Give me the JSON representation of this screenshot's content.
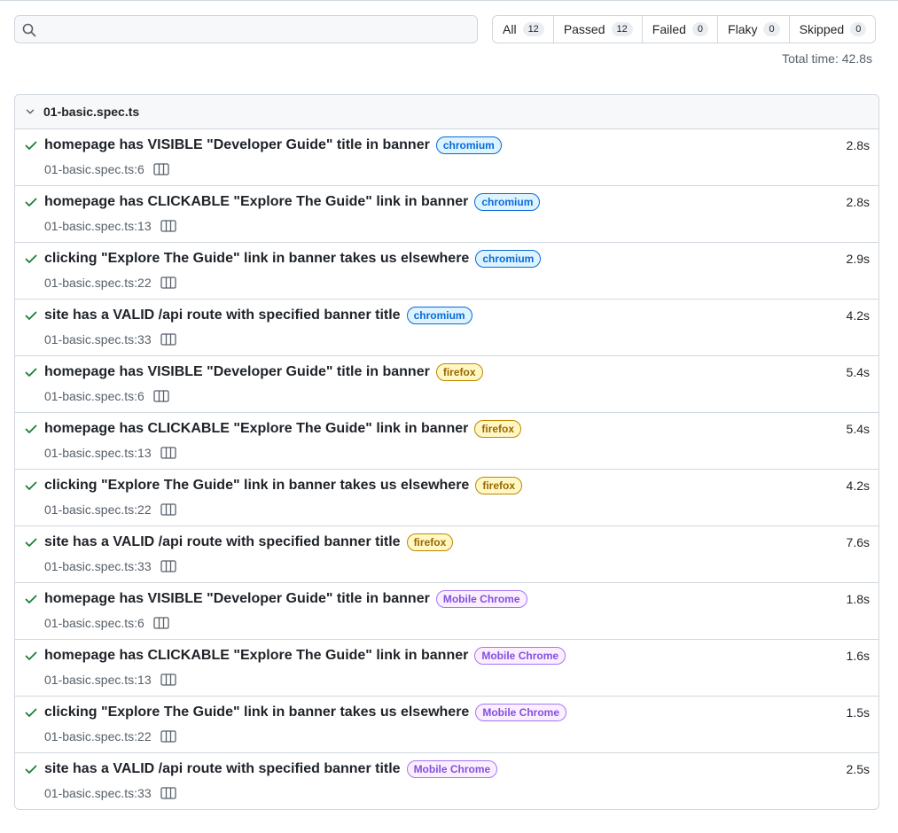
{
  "search": {
    "placeholder": "",
    "value": ""
  },
  "filters": [
    {
      "label": "All",
      "count": "12"
    },
    {
      "label": "Passed",
      "count": "12"
    },
    {
      "label": "Failed",
      "count": "0"
    },
    {
      "label": "Flaky",
      "count": "0"
    },
    {
      "label": "Skipped",
      "count": "0"
    }
  ],
  "total_time": "Total time: 42.8s",
  "file": {
    "name": "01-basic.spec.ts"
  },
  "colors": {
    "pass": "#1a7f37",
    "chromium": "#0969da",
    "firefox": "#bf8700",
    "mobile": "#8250df"
  },
  "tests": [
    {
      "title": "homepage has VISIBLE \"Developer Guide\" title in banner",
      "project": "chromium",
      "location": "01-basic.spec.ts:6",
      "duration": "2.8s",
      "status": "passed",
      "icon": "check-icon"
    },
    {
      "title": "homepage has CLICKABLE \"Explore The Guide\" link in banner",
      "project": "chromium",
      "location": "01-basic.spec.ts:13",
      "duration": "2.8s",
      "status": "passed",
      "icon": "check-icon"
    },
    {
      "title": "clicking \"Explore The Guide\" link in banner takes us elsewhere",
      "project": "chromium",
      "location": "01-basic.spec.ts:22",
      "duration": "2.9s",
      "status": "passed",
      "icon": "check-icon"
    },
    {
      "title": "site has a VALID /api route with specified banner title",
      "project": "chromium",
      "location": "01-basic.spec.ts:33",
      "duration": "4.2s",
      "status": "passed",
      "icon": "check-icon"
    },
    {
      "title": "homepage has VISIBLE \"Developer Guide\" title in banner",
      "project": "firefox",
      "location": "01-basic.spec.ts:6",
      "duration": "5.4s",
      "status": "passed",
      "icon": "check-icon"
    },
    {
      "title": "homepage has CLICKABLE \"Explore The Guide\" link in banner",
      "project": "firefox",
      "location": "01-basic.spec.ts:13",
      "duration": "5.4s",
      "status": "passed",
      "icon": "check-icon"
    },
    {
      "title": "clicking \"Explore The Guide\" link in banner takes us elsewhere",
      "project": "firefox",
      "location": "01-basic.spec.ts:22",
      "duration": "4.2s",
      "status": "passed",
      "icon": "check-icon"
    },
    {
      "title": "site has a VALID /api route with specified banner title",
      "project": "firefox",
      "location": "01-basic.spec.ts:33",
      "duration": "7.6s",
      "status": "passed",
      "icon": "check-icon"
    },
    {
      "title": "homepage has VISIBLE \"Developer Guide\" title in banner",
      "project": "Mobile Chrome",
      "location": "01-basic.spec.ts:6",
      "duration": "1.8s",
      "status": "passed",
      "icon": "check-icon"
    },
    {
      "title": "homepage has CLICKABLE \"Explore The Guide\" link in banner",
      "project": "Mobile Chrome",
      "location": "01-basic.spec.ts:13",
      "duration": "1.6s",
      "status": "passed",
      "icon": "check-icon"
    },
    {
      "title": "clicking \"Explore The Guide\" link in banner takes us elsewhere",
      "project": "Mobile Chrome",
      "location": "01-basic.spec.ts:22",
      "duration": "1.5s",
      "status": "passed",
      "icon": "check-icon"
    },
    {
      "title": "site has a VALID /api route with specified banner title",
      "project": "Mobile Chrome",
      "location": "01-basic.spec.ts:33",
      "duration": "2.5s",
      "status": "passed",
      "icon": "check-icon"
    }
  ]
}
